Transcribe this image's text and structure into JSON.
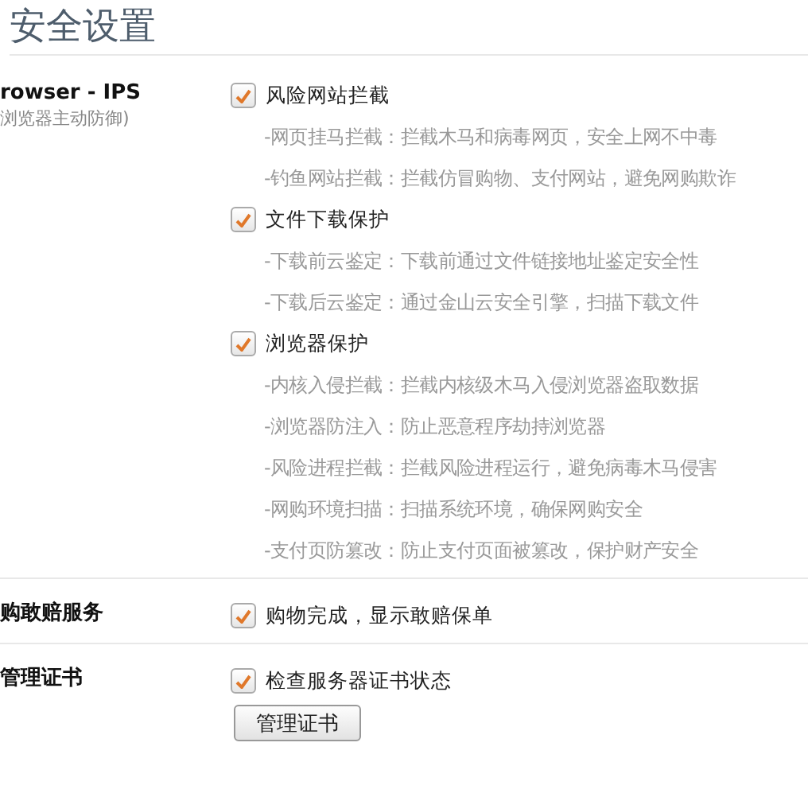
{
  "title": "安全设置",
  "sections": [
    {
      "label": "rowser - IPS",
      "sublabel": "浏览器主动防御)",
      "options": [
        {
          "label": "风险网站拦截",
          "checked": true,
          "details": [
            "-网页挂马拦截：拦截木马和病毒网页，安全上网不中毒",
            "-钓鱼网站拦截：拦截仿冒购物、支付网站，避免网购欺诈"
          ]
        },
        {
          "label": "文件下载保护",
          "checked": true,
          "details": [
            "-下载前云鉴定：下载前通过文件链接地址鉴定安全性",
            "-下载后云鉴定：通过金山云安全引擎，扫描下载文件"
          ]
        },
        {
          "label": "浏览器保护",
          "checked": true,
          "details": [
            "-内核入侵拦截：拦截内核级木马入侵浏览器盗取数据",
            "-浏览器防注入：防止恶意程序劫持浏览器",
            "-风险进程拦截：拦截风险进程运行，避免病毒木马侵害",
            "-网购环境扫描：扫描系统环境，确保网购安全",
            "-支付页防篡改：防止支付页面被篡改，保护财产安全"
          ]
        }
      ]
    },
    {
      "label": "购敢赔服务",
      "options": [
        {
          "label": "购物完成，显示敢赔保单",
          "checked": true
        }
      ]
    },
    {
      "label": "管理证书",
      "options": [
        {
          "label": "检查服务器证书状态",
          "checked": true
        }
      ],
      "button": "管理证书"
    }
  ]
}
